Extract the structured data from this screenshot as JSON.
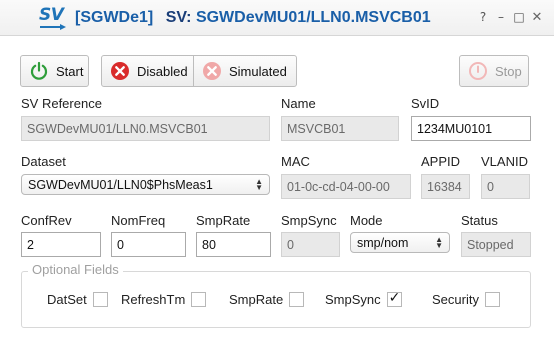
{
  "titlebar": {
    "logo_text": "SV",
    "title_bracket": "[SGWDe1]",
    "title_sv": "SV:",
    "title_ref": "SGWDevMU01/LLN0.MSVCB01",
    "icons": [
      "help-icon",
      "minimize-icon",
      "maximize-icon",
      "close-icon"
    ],
    "help_glyph": "?",
    "min_glyph": "–",
    "max_glyph": "□",
    "close_glyph": "✕"
  },
  "toolbar": {
    "start_label": "Start",
    "disabled_label": "Disabled",
    "simulated_label": "Simulated",
    "stop_label": "Stop"
  },
  "fields": {
    "sv_reference_label": "SV Reference",
    "sv_reference_value": "SGWDevMU01/LLN0.MSVCB01",
    "name_label": "Name",
    "name_value": "MSVCB01",
    "svid_label": "SvID",
    "svid_value": "1234MU0101",
    "dataset_label": "Dataset",
    "dataset_value": "SGWDevMU01/LLN0$PhsMeas1",
    "mac_label": "MAC",
    "mac_value": "01-0c-cd-04-00-00",
    "appid_label": "APPID",
    "appid_value": "16384",
    "vlanid_label": "VLANID",
    "vlanid_value": "0",
    "confrev_label": "ConfRev",
    "confrev_value": "2",
    "nomfreq_label": "NomFreq",
    "nomfreq_value": "0",
    "smprate_label": "SmpRate",
    "smprate_value": "80",
    "smpsync_label": "SmpSync",
    "smpsync_value": "0",
    "mode_label": "Mode",
    "mode_value": "smp/nom",
    "status_label": "Status",
    "status_value": "Stopped"
  },
  "optional_fields": {
    "title": "Optional Fields",
    "items": [
      {
        "label": "DatSet",
        "checked": false
      },
      {
        "label": "RefreshTm",
        "checked": false
      },
      {
        "label": "SmpRate",
        "checked": false
      },
      {
        "label": "SmpSync",
        "checked": true
      },
      {
        "label": "Security",
        "checked": false
      }
    ]
  },
  "colors": {
    "accent": "#1a5fa8",
    "start_green": "#2e9d3a",
    "disabled_red": "#d92b2b",
    "simulated_pink": "#f0a8a8",
    "stop_pink": "#f2b8b8"
  }
}
